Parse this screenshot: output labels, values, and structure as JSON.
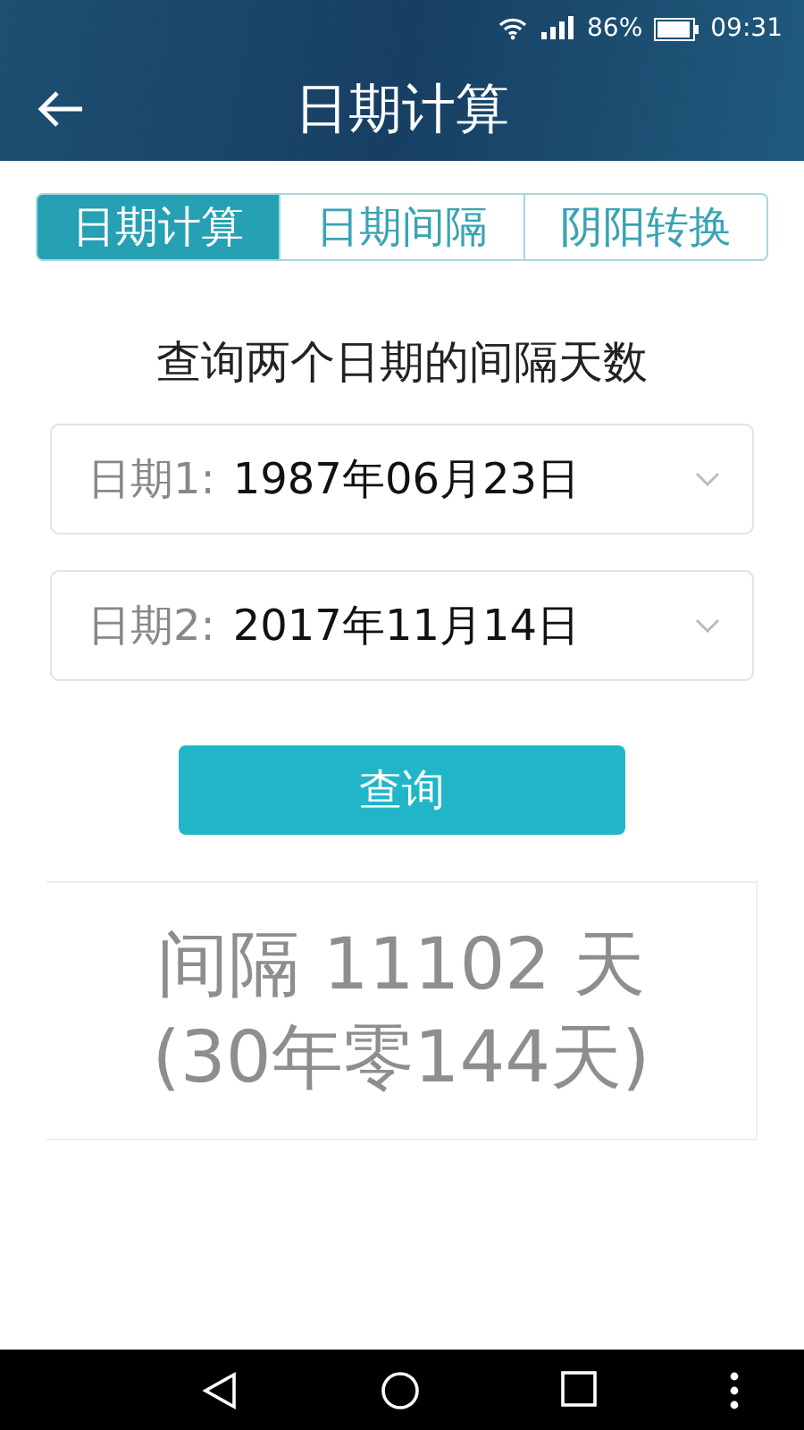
{
  "status_bar": {
    "battery": "86%",
    "time": "09:31"
  },
  "app_bar": {
    "title": "日期计算"
  },
  "tabs": [
    {
      "label": "日期计算",
      "selected": true
    },
    {
      "label": "日期间隔",
      "selected": false
    },
    {
      "label": "阴阳转换",
      "selected": false
    }
  ],
  "heading": "查询两个日期的间隔天数",
  "date_fields": [
    {
      "label": "日期1:",
      "value": "1987年06月23日"
    },
    {
      "label": "日期2:",
      "value": "2017年11月14日"
    }
  ],
  "query_button": "查询",
  "result": {
    "line_1": "间隔 11102 天",
    "line_2": "(30年零144天)"
  }
}
